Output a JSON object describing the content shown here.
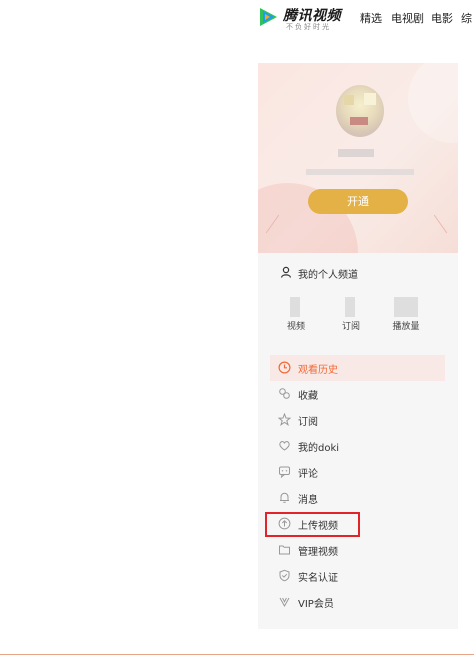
{
  "header": {
    "brand": "腾讯视频",
    "slogan": "不负好时光",
    "nav": [
      "精选",
      "电视剧",
      "电影",
      "综"
    ]
  },
  "profile": {
    "open_button": "开通"
  },
  "channel": {
    "label": "我的个人频道"
  },
  "stats": [
    {
      "label": "视频"
    },
    {
      "label": "订阅"
    },
    {
      "label": "播放量"
    }
  ],
  "menu": [
    {
      "label": "观看历史",
      "icon": "clock-icon",
      "active": true
    },
    {
      "label": "收藏",
      "icon": "favorites-icon"
    },
    {
      "label": "订阅",
      "icon": "star-icon"
    },
    {
      "label": "我的doki",
      "icon": "heart-icon"
    },
    {
      "label": "评论",
      "icon": "comment-icon"
    },
    {
      "label": "消息",
      "icon": "bell-icon"
    },
    {
      "label": "上传视频",
      "icon": "upload-icon",
      "highlighted": true
    },
    {
      "label": "管理视频",
      "icon": "folder-icon"
    },
    {
      "label": "实名认证",
      "icon": "shield-check-icon"
    },
    {
      "label": "VIP会员",
      "icon": "vip-icon"
    }
  ],
  "colors": {
    "accent": "#f06a35",
    "gold_button": "#e3b146",
    "highlight_box": "#e0242a",
    "brand_green": "#2fc15a",
    "brand_blue": "#1f9cf0",
    "brand_orange": "#f6a623"
  }
}
